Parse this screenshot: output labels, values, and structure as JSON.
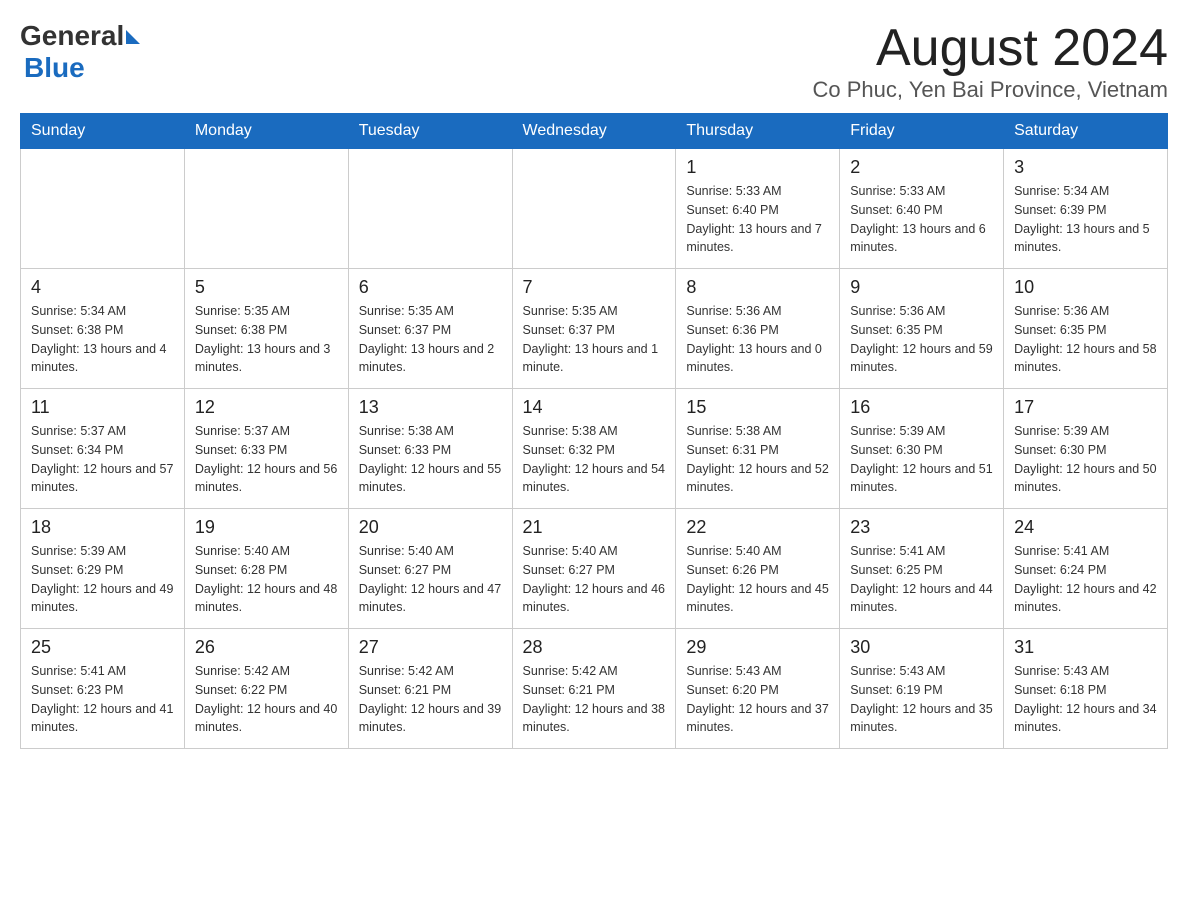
{
  "header": {
    "logo_general": "General",
    "logo_blue": "Blue",
    "title": "August 2024",
    "subtitle": "Co Phuc, Yen Bai Province, Vietnam"
  },
  "weekdays": [
    "Sunday",
    "Monday",
    "Tuesday",
    "Wednesday",
    "Thursday",
    "Friday",
    "Saturday"
  ],
  "weeks": [
    [
      {
        "day": "",
        "info": ""
      },
      {
        "day": "",
        "info": ""
      },
      {
        "day": "",
        "info": ""
      },
      {
        "day": "",
        "info": ""
      },
      {
        "day": "1",
        "info": "Sunrise: 5:33 AM\nSunset: 6:40 PM\nDaylight: 13 hours and 7 minutes."
      },
      {
        "day": "2",
        "info": "Sunrise: 5:33 AM\nSunset: 6:40 PM\nDaylight: 13 hours and 6 minutes."
      },
      {
        "day": "3",
        "info": "Sunrise: 5:34 AM\nSunset: 6:39 PM\nDaylight: 13 hours and 5 minutes."
      }
    ],
    [
      {
        "day": "4",
        "info": "Sunrise: 5:34 AM\nSunset: 6:38 PM\nDaylight: 13 hours and 4 minutes."
      },
      {
        "day": "5",
        "info": "Sunrise: 5:35 AM\nSunset: 6:38 PM\nDaylight: 13 hours and 3 minutes."
      },
      {
        "day": "6",
        "info": "Sunrise: 5:35 AM\nSunset: 6:37 PM\nDaylight: 13 hours and 2 minutes."
      },
      {
        "day": "7",
        "info": "Sunrise: 5:35 AM\nSunset: 6:37 PM\nDaylight: 13 hours and 1 minute."
      },
      {
        "day": "8",
        "info": "Sunrise: 5:36 AM\nSunset: 6:36 PM\nDaylight: 13 hours and 0 minutes."
      },
      {
        "day": "9",
        "info": "Sunrise: 5:36 AM\nSunset: 6:35 PM\nDaylight: 12 hours and 59 minutes."
      },
      {
        "day": "10",
        "info": "Sunrise: 5:36 AM\nSunset: 6:35 PM\nDaylight: 12 hours and 58 minutes."
      }
    ],
    [
      {
        "day": "11",
        "info": "Sunrise: 5:37 AM\nSunset: 6:34 PM\nDaylight: 12 hours and 57 minutes."
      },
      {
        "day": "12",
        "info": "Sunrise: 5:37 AM\nSunset: 6:33 PM\nDaylight: 12 hours and 56 minutes."
      },
      {
        "day": "13",
        "info": "Sunrise: 5:38 AM\nSunset: 6:33 PM\nDaylight: 12 hours and 55 minutes."
      },
      {
        "day": "14",
        "info": "Sunrise: 5:38 AM\nSunset: 6:32 PM\nDaylight: 12 hours and 54 minutes."
      },
      {
        "day": "15",
        "info": "Sunrise: 5:38 AM\nSunset: 6:31 PM\nDaylight: 12 hours and 52 minutes."
      },
      {
        "day": "16",
        "info": "Sunrise: 5:39 AM\nSunset: 6:30 PM\nDaylight: 12 hours and 51 minutes."
      },
      {
        "day": "17",
        "info": "Sunrise: 5:39 AM\nSunset: 6:30 PM\nDaylight: 12 hours and 50 minutes."
      }
    ],
    [
      {
        "day": "18",
        "info": "Sunrise: 5:39 AM\nSunset: 6:29 PM\nDaylight: 12 hours and 49 minutes."
      },
      {
        "day": "19",
        "info": "Sunrise: 5:40 AM\nSunset: 6:28 PM\nDaylight: 12 hours and 48 minutes."
      },
      {
        "day": "20",
        "info": "Sunrise: 5:40 AM\nSunset: 6:27 PM\nDaylight: 12 hours and 47 minutes."
      },
      {
        "day": "21",
        "info": "Sunrise: 5:40 AM\nSunset: 6:27 PM\nDaylight: 12 hours and 46 minutes."
      },
      {
        "day": "22",
        "info": "Sunrise: 5:40 AM\nSunset: 6:26 PM\nDaylight: 12 hours and 45 minutes."
      },
      {
        "day": "23",
        "info": "Sunrise: 5:41 AM\nSunset: 6:25 PM\nDaylight: 12 hours and 44 minutes."
      },
      {
        "day": "24",
        "info": "Sunrise: 5:41 AM\nSunset: 6:24 PM\nDaylight: 12 hours and 42 minutes."
      }
    ],
    [
      {
        "day": "25",
        "info": "Sunrise: 5:41 AM\nSunset: 6:23 PM\nDaylight: 12 hours and 41 minutes."
      },
      {
        "day": "26",
        "info": "Sunrise: 5:42 AM\nSunset: 6:22 PM\nDaylight: 12 hours and 40 minutes."
      },
      {
        "day": "27",
        "info": "Sunrise: 5:42 AM\nSunset: 6:21 PM\nDaylight: 12 hours and 39 minutes."
      },
      {
        "day": "28",
        "info": "Sunrise: 5:42 AM\nSunset: 6:21 PM\nDaylight: 12 hours and 38 minutes."
      },
      {
        "day": "29",
        "info": "Sunrise: 5:43 AM\nSunset: 6:20 PM\nDaylight: 12 hours and 37 minutes."
      },
      {
        "day": "30",
        "info": "Sunrise: 5:43 AM\nSunset: 6:19 PM\nDaylight: 12 hours and 35 minutes."
      },
      {
        "day": "31",
        "info": "Sunrise: 5:43 AM\nSunset: 6:18 PM\nDaylight: 12 hours and 34 minutes."
      }
    ]
  ]
}
